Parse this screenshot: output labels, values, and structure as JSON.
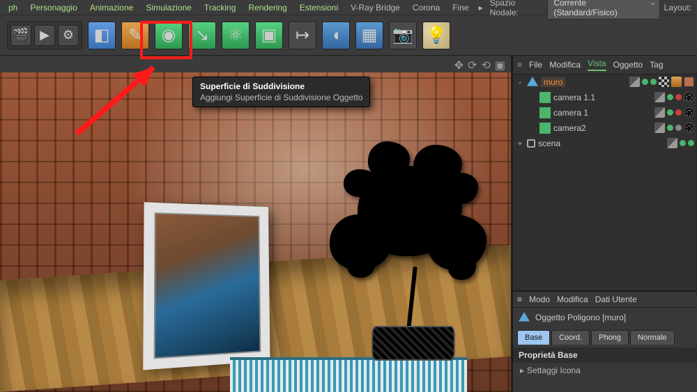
{
  "menu": {
    "items": [
      "ph",
      "Personaggio",
      "Animazione",
      "Simulazione",
      "Tracking",
      "Rendering",
      "Estensioni",
      "V-Ray Bridge",
      "Corona",
      "Fine"
    ],
    "spazio_label": "Spazio Nodale:",
    "spazio_value": "Corrente (Standard/Fisico)",
    "layout_label": "Layout:"
  },
  "toolbar": {
    "clapper": "🎬",
    "play": "▶",
    "gear": "⚙",
    "cube": "◧",
    "pen": "✎",
    "subdiv": "◉",
    "subdiv2": "↘",
    "atom": "⚛",
    "boxes": "▣",
    "arrowout": "↦",
    "bend": "◖",
    "grid": "▦",
    "camera": "📷",
    "light": "💡"
  },
  "tooltip": {
    "title": "Superficie di Suddivisione",
    "sub": "Aggiungi Superficie di Suddivisione Oggetto"
  },
  "viewport": {
    "icons": [
      "✥",
      "⟳",
      "⟲",
      "▣"
    ]
  },
  "objpanel": {
    "tabs": [
      "File",
      "Modifica",
      "Vista",
      "Oggetto",
      "Tag"
    ],
    "active": "Vista",
    "rows": [
      {
        "tw": "-",
        "icon": "poly",
        "name": "muro",
        "selected": true,
        "tags": [
          "layer",
          "dot g",
          "dot g",
          "checker",
          "orange",
          "brick"
        ]
      },
      {
        "tw": "",
        "icon": "cam",
        "name": "camera 1.1",
        "indent": 1,
        "tags": [
          "layer",
          "dot g",
          "dot r",
          "black"
        ]
      },
      {
        "tw": "",
        "icon": "cam",
        "name": "camera 1",
        "indent": 1,
        "tags": [
          "layer",
          "dot g",
          "dot r",
          "black"
        ]
      },
      {
        "tw": "",
        "icon": "cam",
        "name": "camera2",
        "indent": 1,
        "tags": [
          "layer",
          "dot g",
          "dot gray",
          "black"
        ]
      },
      {
        "tw": "+",
        "icon": "null",
        "name": "scena",
        "indent": 0,
        "tags": [
          "layer",
          "dot g",
          "dot g"
        ]
      }
    ]
  },
  "attr": {
    "tabs": [
      "Modo",
      "Modifica",
      "Dati Utente"
    ],
    "title": "Oggetto Poligono [muro]",
    "subtabs": [
      "Base",
      "Coord.",
      "Phong",
      "Normale"
    ],
    "active": "Base",
    "section": "Proprietà Base",
    "row": "Settaggi Icona"
  }
}
